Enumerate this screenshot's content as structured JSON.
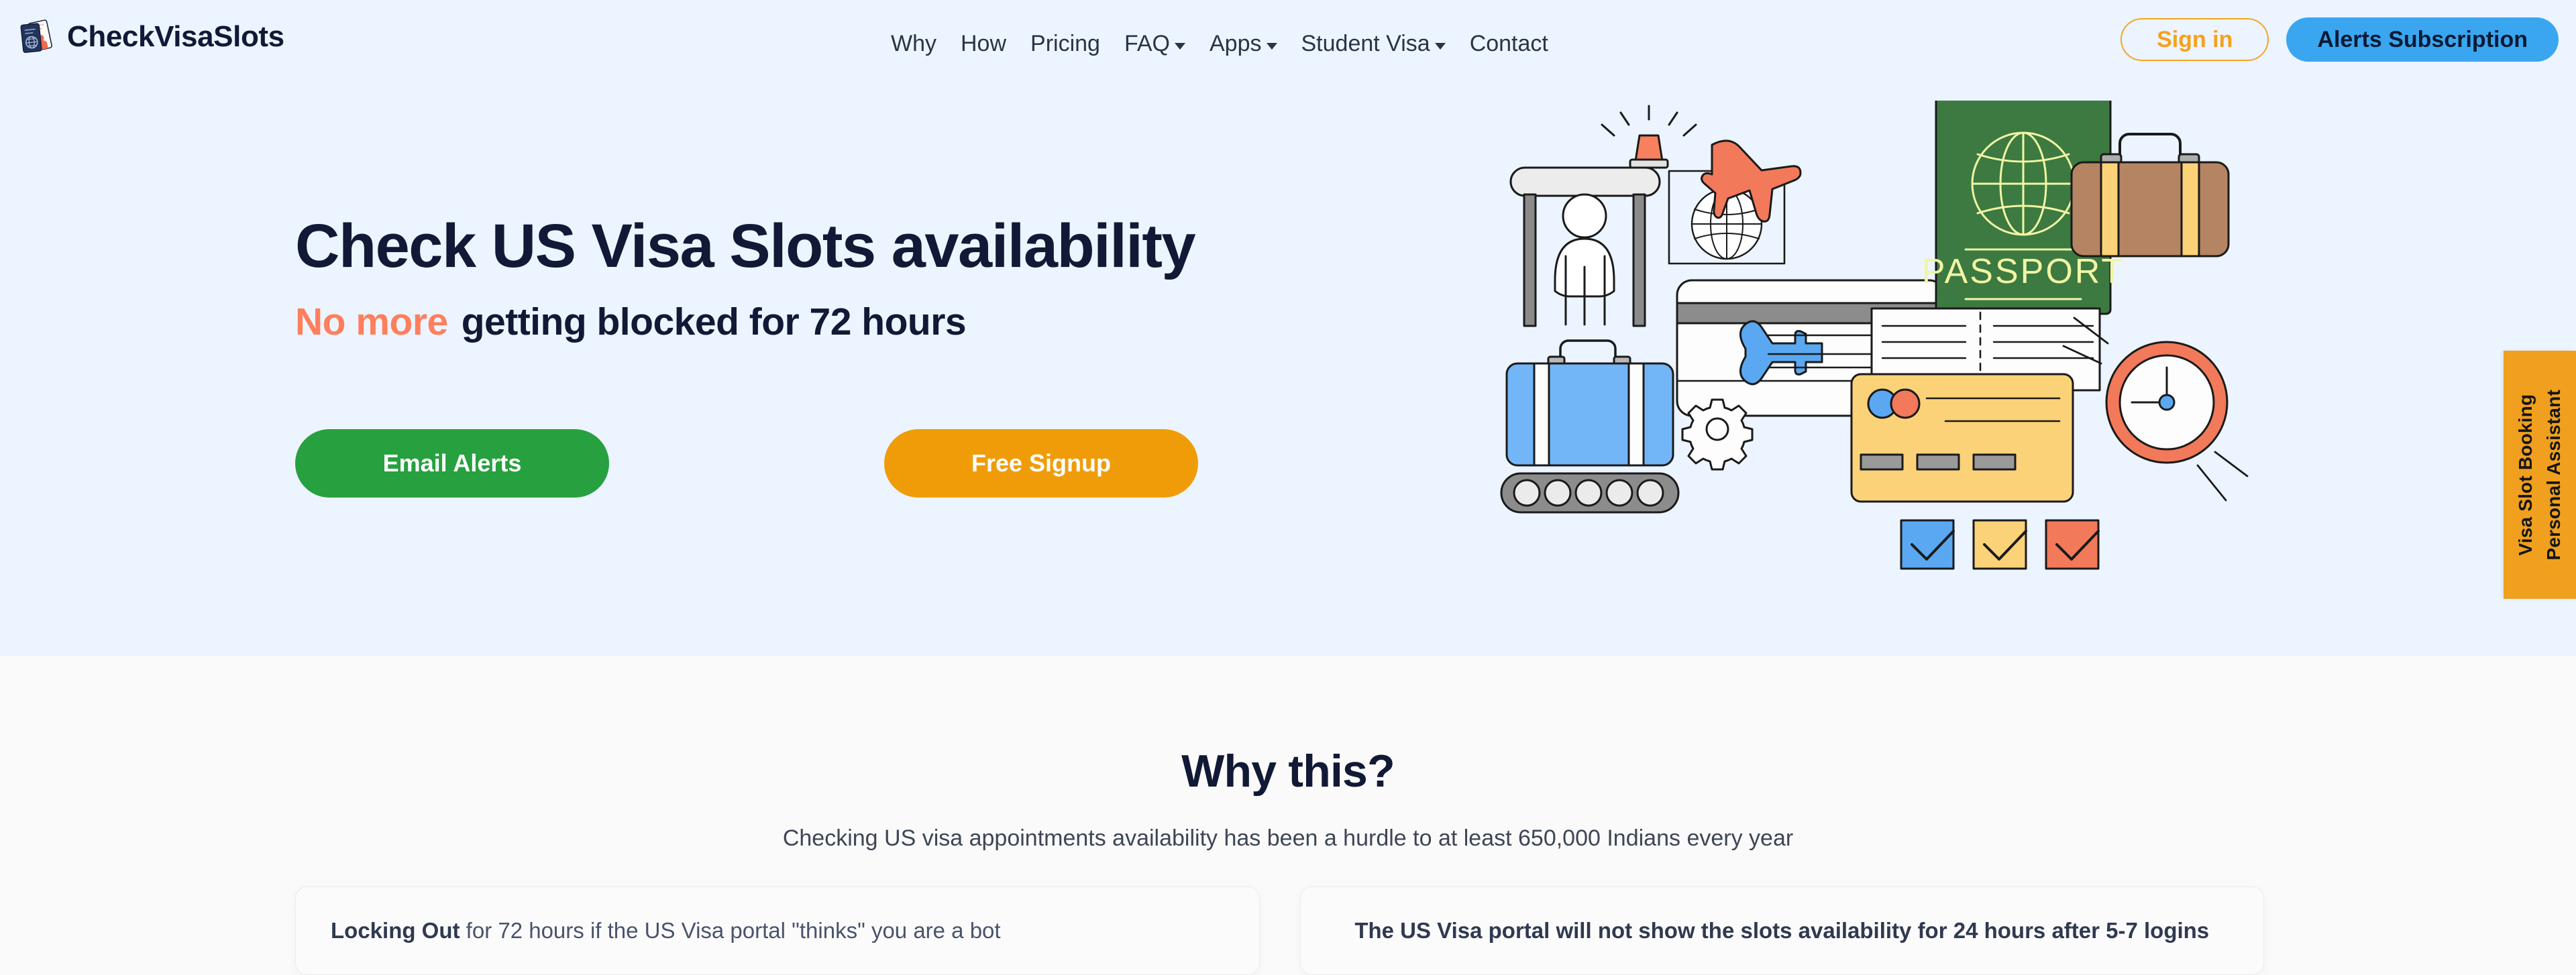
{
  "brand": {
    "name": "CheckVisaSlots",
    "logo_icon": "passport-logo-icon"
  },
  "nav": {
    "links": [
      {
        "label": "Why",
        "has_caret": false
      },
      {
        "label": "How",
        "has_caret": false
      },
      {
        "label": "Pricing",
        "has_caret": false
      },
      {
        "label": "FAQ",
        "has_caret": true
      },
      {
        "label": "Apps",
        "has_caret": true
      },
      {
        "label": "Student Visa",
        "has_caret": true
      },
      {
        "label": "Contact",
        "has_caret": false
      }
    ],
    "sign_in_label": "Sign in",
    "alerts_label": "Alerts Subscription"
  },
  "hero": {
    "title": "Check US Visa Slots availability",
    "subtitle_accent": "No more",
    "subtitle_rest": "getting blocked for 72 hours",
    "cta_primary": "Email Alerts",
    "cta_secondary": "Free Signup",
    "illustration_name": "travel-visa-illustration"
  },
  "side_tab": {
    "label": "Visa Slot Booking\nPersonal Assistant"
  },
  "why": {
    "title": "Why this?",
    "subtitle": "Checking US visa appointments availability has been a hurdle to at least 650,000 Indians every year",
    "cards": [
      {
        "lead": "Locking Out",
        "rest": " for 72 hours if the US Visa portal \"thinks\" you are a bot"
      },
      {
        "lead": "",
        "rest": "The US Visa portal will not show the slots availability for 24 hours after 5-7 logins"
      }
    ]
  },
  "colors": {
    "hero_bg": "#ecf4ff",
    "page_bg": "#fafafa",
    "navy_text": "#111936",
    "accent_orange": "#ff7f5c",
    "brand_orange": "#f5a623",
    "brand_blue": "#3aa6f0",
    "green_cta": "#27a03f",
    "amber_cta": "#f09c09",
    "side_tab": "#f0a01e"
  }
}
